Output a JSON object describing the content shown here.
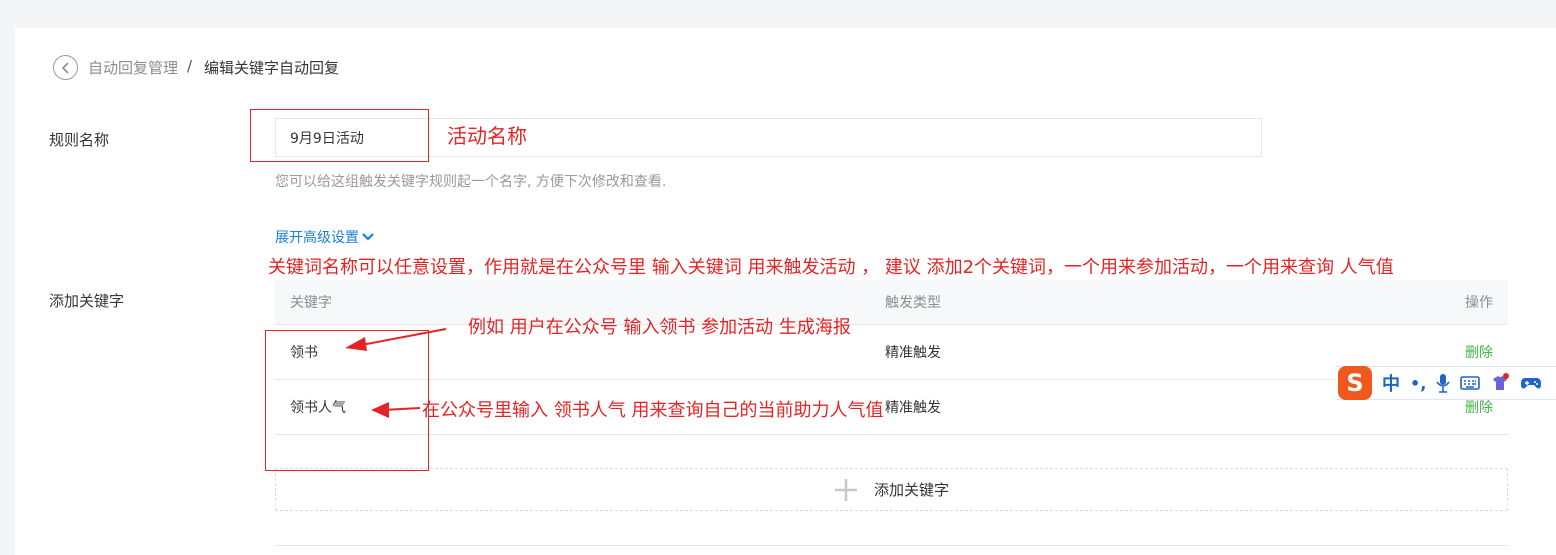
{
  "breadcrumb": {
    "parent": "自动回复管理",
    "separator": "/",
    "current": "编辑关键字自动回复"
  },
  "form": {
    "rule_name_label": "规则名称",
    "rule_name_value": "9月9日活动",
    "rule_name_hint": "您可以给这组触发关键字规则起一个名字, 方便下次修改和查看.",
    "advanced_toggle": "展开高级设置",
    "add_keyword_label": "添加关键字"
  },
  "keyword_table": {
    "headers": [
      "关键字",
      "触发类型",
      "操作"
    ],
    "rows": [
      {
        "keyword": "领书",
        "trigger_type": "精准触发",
        "action": "删除"
      },
      {
        "keyword": "领书人气",
        "trigger_type": "精准触发",
        "action": "删除"
      }
    ],
    "add_button": "添加关键字"
  },
  "annotations": {
    "activity_name": "活动名称",
    "keyword_note": "关键词名称可以任意设置，作用就是在公众号里 输入关键词 用来触发活动 ， 建议 添加2个关键词，一个用来参加活动，一个用来查询 人气值",
    "example_note": "例如  用户在公众号 输入领书 参加活动 生成海报",
    "query_note": "在公众号里输入 领书人气 用来查询自己的当前助力人气值"
  },
  "ime_toolbar": {
    "logo": "S",
    "mode": "中",
    "punct": "•,"
  },
  "colors": {
    "annotation_red": "#e42424",
    "link_blue": "#1b7ed8",
    "delete_green": "#44b549",
    "ime_orange": "#f0591d"
  }
}
